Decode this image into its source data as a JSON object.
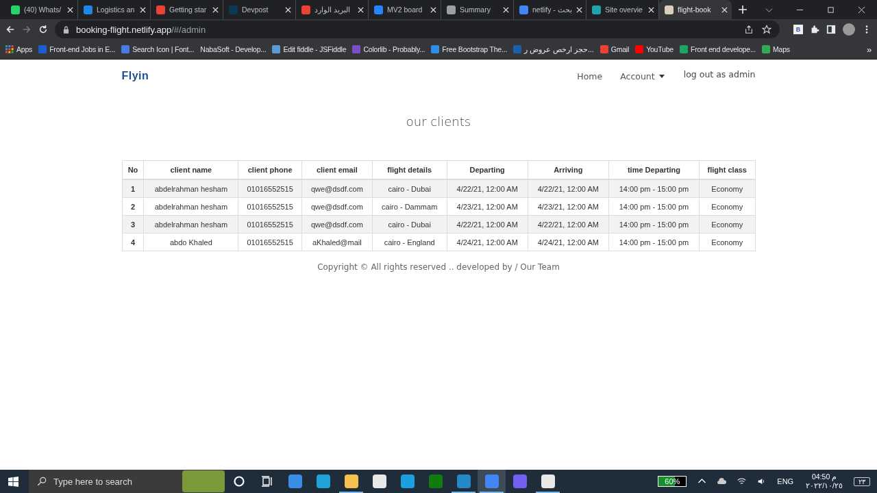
{
  "browser": {
    "tabs": [
      {
        "label": "(40) Whats/",
        "selected": false,
        "color": "#25d366"
      },
      {
        "label": "Logistics an",
        "selected": false,
        "color": "#1e88e5"
      },
      {
        "label": "Getting star",
        "selected": false,
        "color": "#ea4335"
      },
      {
        "label": "Devpost",
        "selected": false,
        "color": "#0b3954"
      },
      {
        "label": "البريد الوارد",
        "selected": false,
        "color": "#ea4335"
      },
      {
        "label": "MV2 board",
        "selected": false,
        "color": "#2684ff"
      },
      {
        "label": "Summary",
        "selected": false,
        "color": "#9aa0a6"
      },
      {
        "label": "netlify - بحث",
        "selected": false,
        "color": "#4285f4"
      },
      {
        "label": "Site overvie",
        "selected": false,
        "color": "#20a3a8"
      },
      {
        "label": "flight-book",
        "selected": true,
        "color": "#d9cfb8"
      }
    ],
    "url_host": "booking-flight.netlify.app",
    "url_path": "/#/admin",
    "bookmarks": [
      {
        "kind": "apps",
        "label": "Apps"
      },
      {
        "kind": "link",
        "label": "Front-end Jobs in E...",
        "color": "#1a5fd0"
      },
      {
        "kind": "link",
        "label": "Search Icon | Font...",
        "color": "#4a7be0"
      },
      {
        "kind": "plain",
        "label": "NabaSoft - Develop..."
      },
      {
        "kind": "link",
        "label": "Edit fiddle - JSFiddle",
        "color": "#5b9bd5"
      },
      {
        "kind": "link",
        "label": "Colorlib - Probably...",
        "color": "#7d4cc9"
      },
      {
        "kind": "link",
        "label": "Free Bootstrap The...",
        "color": "#2f8fe8"
      },
      {
        "kind": "link",
        "label": "حجز ارخص عروض ر...",
        "color": "#1d5fa8"
      },
      {
        "kind": "link",
        "label": "Gmail",
        "color": "#ea4335"
      },
      {
        "kind": "link",
        "label": "YouTube",
        "color": "#ff0000"
      },
      {
        "kind": "link",
        "label": "Front end develope...",
        "color": "#1ea362"
      },
      {
        "kind": "link",
        "label": "Maps",
        "color": "#34a853"
      }
    ],
    "more": "»",
    "extension_badge": "B"
  },
  "page": {
    "logo": "Flyin",
    "nav": [
      {
        "kind": "link",
        "label": "Home"
      },
      {
        "kind": "dropdown",
        "label": "Account"
      },
      {
        "kind": "link",
        "label": "log out as admin"
      }
    ],
    "title": "our clients",
    "table": {
      "columns": [
        "No",
        "client name",
        "client phone",
        "client email",
        "flight details",
        "Departing",
        "Arriving",
        "time Departing",
        "flight class"
      ],
      "rows": [
        [
          "1",
          "abdelrahman hesham",
          "01016552515",
          "qwe@dsdf.com",
          "cairo - Dubai",
          "4/22/21, 12:00 AM",
          "4/22/21, 12:00 AM",
          "14:00 pm - 15:00 pm",
          "Economy"
        ],
        [
          "2",
          "abdelrahman hesham",
          "01016552515",
          "qwe@dsdf.com",
          "cairo - Dammam",
          "4/23/21, 12:00 AM",
          "4/23/21, 12:00 AM",
          "14:00 pm - 15:00 pm",
          "Economy"
        ],
        [
          "3",
          "abdelrahman hesham",
          "01016552515",
          "qwe@dsdf.com",
          "cairo - Dubai",
          "4/22/21, 12:00 AM",
          "4/22/21, 12:00 AM",
          "14:00 pm - 15:00 pm",
          "Economy"
        ],
        [
          "4",
          "abdo Khaled",
          "01016552515",
          "aKhaled@mail",
          "cairo - England",
          "4/24/21, 12:00 AM",
          "4/24/21, 12:00 AM",
          "14:00 pm - 15:00 pm",
          "Economy"
        ]
      ]
    },
    "footer": "Copyright © All rights reserved .. developed by / Our Team"
  },
  "taskbar": {
    "search_placeholder": "Type here to search",
    "apps": [
      {
        "kind": "cortana",
        "running": false,
        "selected": false
      },
      {
        "kind": "taskview",
        "running": false,
        "selected": false
      },
      {
        "kind": "mail",
        "running": false,
        "selected": false
      },
      {
        "kind": "edge",
        "running": false,
        "selected": false
      },
      {
        "kind": "files",
        "running": true,
        "selected": false
      },
      {
        "kind": "store",
        "running": false,
        "selected": false
      },
      {
        "kind": "letter",
        "running": false,
        "selected": false
      },
      {
        "kind": "xbox",
        "running": false,
        "selected": false
      },
      {
        "kind": "vscode",
        "running": true,
        "selected": false
      },
      {
        "kind": "chrome",
        "running": true,
        "selected": true
      },
      {
        "kind": "viber",
        "running": false,
        "selected": false
      },
      {
        "kind": "slack",
        "running": true,
        "selected": false
      }
    ],
    "battery": {
      "level": 0.6,
      "reading": "60%"
    },
    "language": "ENG",
    "time": "04:50 م",
    "date": "٢٠٢٢/١٠/٢٥",
    "notifications": "٢٣"
  }
}
